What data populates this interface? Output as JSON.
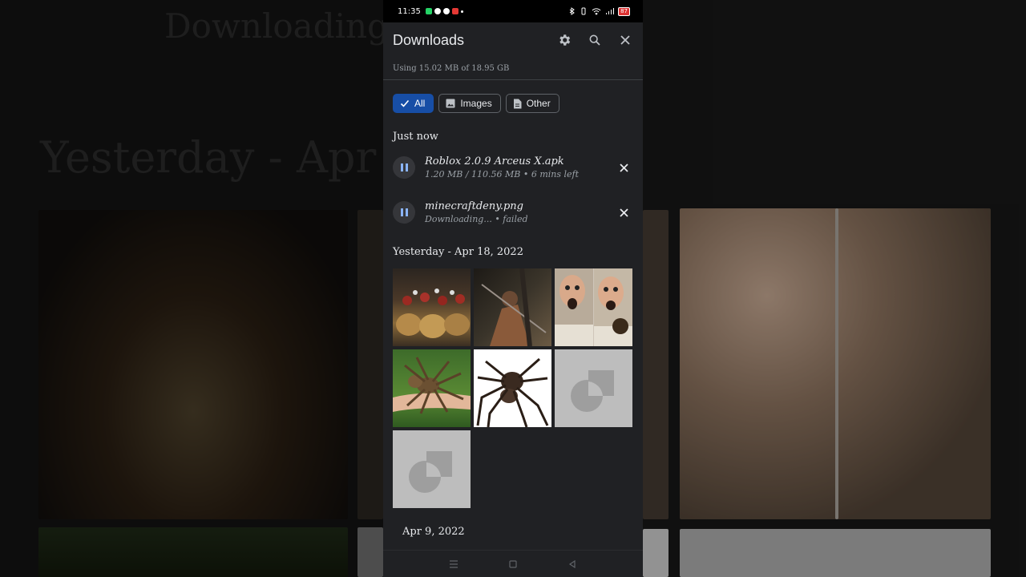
{
  "status_bar": {
    "time": "11:35",
    "battery": "87"
  },
  "background_echo": {
    "title": "Downloading...",
    "heading": "Yesterday - Apr"
  },
  "appbar": {
    "title": "Downloads",
    "settings_icon": "gear-icon",
    "search_icon": "search-icon",
    "close_icon": "close-icon"
  },
  "usage_text": "Using 15.02 MB of 18.95 GB",
  "filters": [
    {
      "label": "All",
      "icon": "check-icon",
      "selected": true
    },
    {
      "label": "Images",
      "icon": "image-icon",
      "selected": false
    },
    {
      "label": "Other",
      "icon": "document-icon",
      "selected": false
    }
  ],
  "sections": {
    "just_now": "Just now",
    "yesterday": "Yesterday - Apr 18, 2022",
    "apr9": "Apr 9, 2022"
  },
  "downloads": [
    {
      "name": "Roblox 2.0.9 Arceus X.apk",
      "status": "1.20 MB / 110.56 MB • 6 mins left"
    },
    {
      "name": "minecraftdeny.png",
      "status": "Downloading... • failed"
    }
  ],
  "thumbnails": [
    {
      "kind": "photo",
      "subject": "spartan-soldiers"
    },
    {
      "kind": "photo",
      "subject": "spartan-warrior"
    },
    {
      "kind": "photo",
      "subject": "screaming-man-tarantula"
    },
    {
      "kind": "photo",
      "subject": "tarantula-on-arm"
    },
    {
      "kind": "photo",
      "subject": "giant-spider"
    },
    {
      "kind": "placeholder",
      "subject": "image-placeholder-icon"
    },
    {
      "kind": "placeholder",
      "subject": "image-placeholder-icon"
    }
  ],
  "colors": {
    "accent": "#174ea6",
    "background": "#202124",
    "text": "#e8eaed",
    "muted": "#9aa0a6"
  }
}
